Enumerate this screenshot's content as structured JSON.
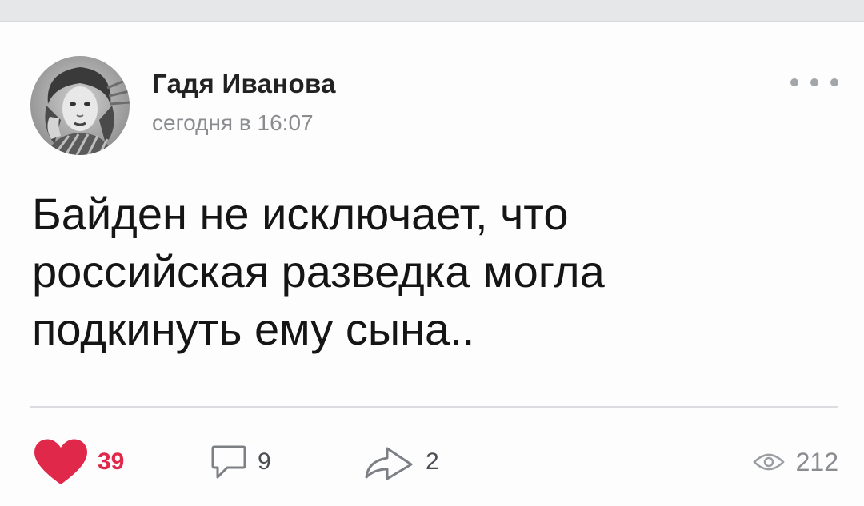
{
  "post": {
    "author": "Гадя Иванова",
    "time": "сегодня в 16:07",
    "text": "Байден не исключает, что\nроссийская разведка могла\nподкинуть ему сына.."
  },
  "actions": {
    "likes": "39",
    "comments": "9",
    "shares": "2",
    "views": "212"
  },
  "icons": {
    "avatar": "avatar-photo",
    "more": "more-icon",
    "like": "heart-icon",
    "comment": "comment-icon",
    "share": "share-icon",
    "views": "eye-icon"
  },
  "colors": {
    "like_accent": "#e0284a",
    "muted": "#8a8c90",
    "divider": "#dcdde0"
  }
}
